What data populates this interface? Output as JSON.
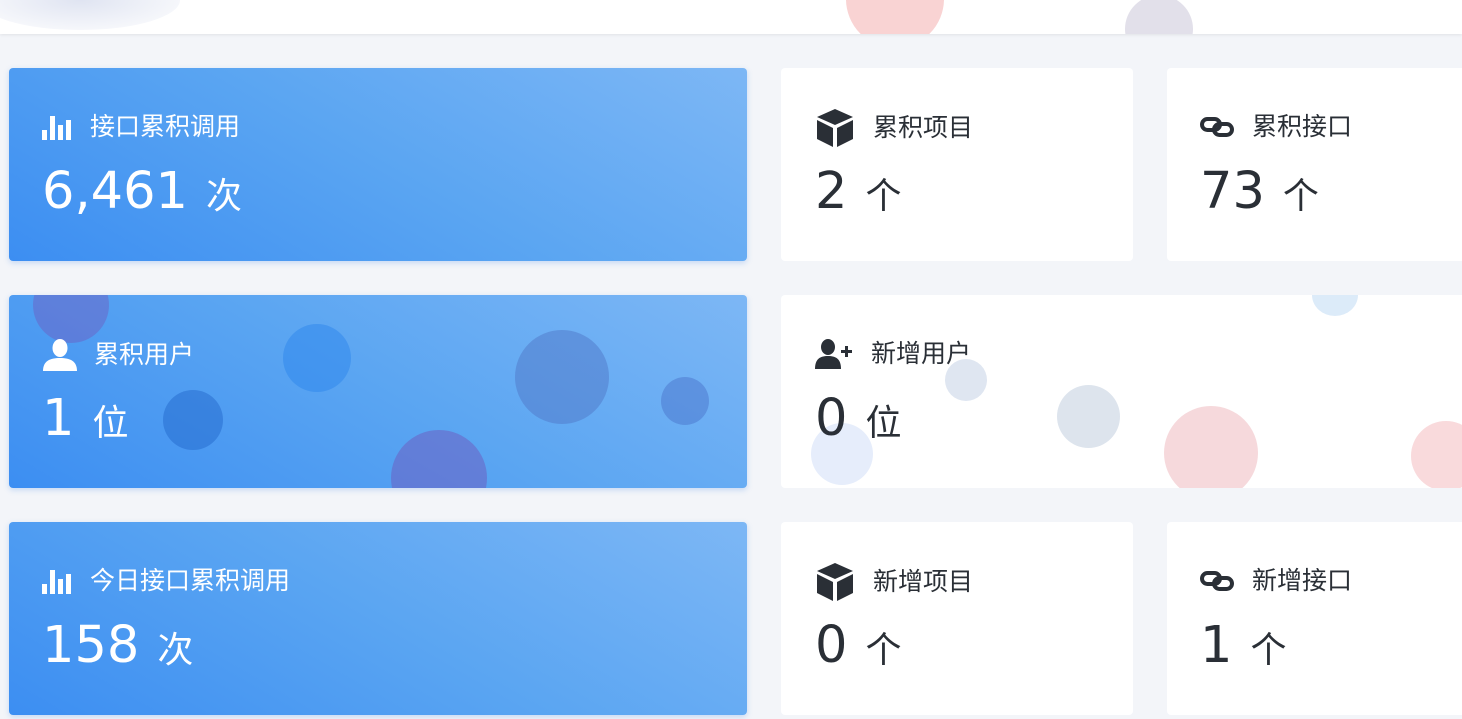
{
  "stats": {
    "total_calls": {
      "title": "接口累积调用",
      "value": "6,461",
      "unit": "次"
    },
    "total_projects": {
      "title": "累积项目",
      "value": "2",
      "unit": "个"
    },
    "total_apis": {
      "title": "累积接口",
      "value": "73",
      "unit": "个"
    },
    "total_users": {
      "title": "累积用户",
      "value": "1",
      "unit": "位"
    },
    "new_users": {
      "title": "新增用户",
      "value": "0",
      "unit": "位"
    },
    "today_calls": {
      "title": "今日接口累积调用",
      "value": "158",
      "unit": "次"
    },
    "new_projects": {
      "title": "新增项目",
      "value": "0",
      "unit": "个"
    },
    "new_apis": {
      "title": "新增接口",
      "value": "1",
      "unit": "个"
    }
  },
  "icons": {
    "calls": "bar-chart-icon",
    "projects": "cube-icon",
    "apis": "link-icon",
    "users": "user-icon",
    "new_users": "user-plus-icon"
  },
  "colors": {
    "blue_card_start": "#3c8ef2",
    "blue_card_end": "#7db7f5",
    "page_background": "#f3f5f9",
    "text_dark": "#2a2f36"
  }
}
